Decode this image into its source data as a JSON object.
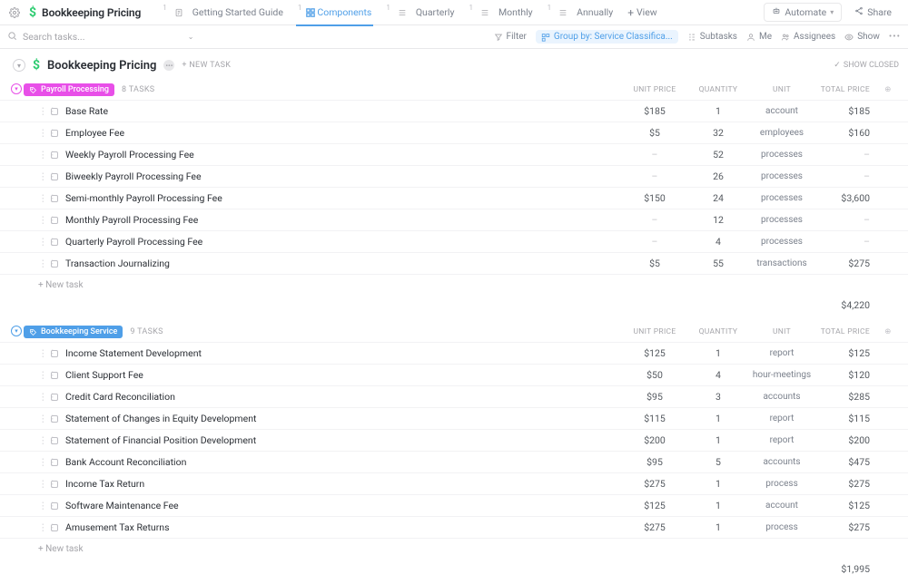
{
  "header": {
    "title": "Bookkeeping Pricing",
    "tabs": [
      {
        "label": "Getting Started Guide"
      },
      {
        "label": "Components",
        "active": true
      },
      {
        "label": "Quarterly"
      },
      {
        "label": "Monthly"
      },
      {
        "label": "Annually"
      }
    ],
    "add_view": "View",
    "automate": "Automate",
    "share": "Share"
  },
  "toolbar": {
    "search_placeholder": "Search tasks...",
    "filter": "Filter",
    "group_by": "Group by: Service Classifica...",
    "subtasks": "Subtasks",
    "me": "Me",
    "assignees": "Assignees",
    "show": "Show"
  },
  "list": {
    "title": "Bookkeeping Pricing",
    "new_task": "+ NEW TASK",
    "show_closed": "SHOW CLOSED"
  },
  "columns": {
    "unit_price": "UNIT PRICE",
    "quantity": "QUANTITY",
    "unit": "UNIT",
    "total_price": "TOTAL PRICE"
  },
  "groups": [
    {
      "name": "Payroll Processing",
      "color": "pink",
      "count": "8 TASKS",
      "subtotal": "$4,220",
      "tasks": [
        {
          "name": "Base Rate",
          "unit_price": "$185",
          "quantity": "1",
          "unit": "account",
          "total_price": "$185"
        },
        {
          "name": "Employee Fee",
          "unit_price": "$5",
          "quantity": "32",
          "unit": "employees",
          "total_price": "$160"
        },
        {
          "name": "Weekly Payroll Processing Fee",
          "unit_price": "–",
          "quantity": "52",
          "unit": "processes",
          "total_price": "–"
        },
        {
          "name": "Biweekly Payroll Processing Fee",
          "unit_price": "–",
          "quantity": "26",
          "unit": "processes",
          "total_price": "–"
        },
        {
          "name": "Semi-monthly Payroll Processing Fee",
          "unit_price": "$150",
          "quantity": "24",
          "unit": "processes",
          "total_price": "$3,600"
        },
        {
          "name": "Monthly Payroll Processing Fee",
          "unit_price": "–",
          "quantity": "12",
          "unit": "processes",
          "total_price": "–"
        },
        {
          "name": "Quarterly Payroll Processing Fee",
          "unit_price": "–",
          "quantity": "4",
          "unit": "processes",
          "total_price": "–"
        },
        {
          "name": "Transaction Journalizing",
          "unit_price": "$5",
          "quantity": "55",
          "unit": "transactions",
          "total_price": "$275"
        }
      ],
      "new_task": "+ New task"
    },
    {
      "name": "Bookkeeping Service",
      "color": "blue",
      "count": "9 TASKS",
      "subtotal": "$1,995",
      "tasks": [
        {
          "name": "Income Statement Development",
          "unit_price": "$125",
          "quantity": "1",
          "unit": "report",
          "total_price": "$125"
        },
        {
          "name": "Client Support Fee",
          "unit_price": "$50",
          "quantity": "4",
          "unit": "hour-meetings",
          "total_price": "$120"
        },
        {
          "name": "Credit Card Reconciliation",
          "unit_price": "$95",
          "quantity": "3",
          "unit": "accounts",
          "total_price": "$285"
        },
        {
          "name": "Statement of Changes in Equity Development",
          "unit_price": "$115",
          "quantity": "1",
          "unit": "report",
          "total_price": "$115"
        },
        {
          "name": "Statement of Financial Position Development",
          "unit_price": "$200",
          "quantity": "1",
          "unit": "report",
          "total_price": "$200"
        },
        {
          "name": "Bank Account Reconciliation",
          "unit_price": "$95",
          "quantity": "5",
          "unit": "accounts",
          "total_price": "$475"
        },
        {
          "name": "Income Tax Return",
          "unit_price": "$275",
          "quantity": "1",
          "unit": "process",
          "total_price": "$275"
        },
        {
          "name": "Software Maintenance Fee",
          "unit_price": "$125",
          "quantity": "1",
          "unit": "account",
          "total_price": "$125"
        },
        {
          "name": "Amusement Tax Returns",
          "unit_price": "$275",
          "quantity": "1",
          "unit": "process",
          "total_price": "$275"
        }
      ],
      "new_task": "+ New task"
    }
  ]
}
